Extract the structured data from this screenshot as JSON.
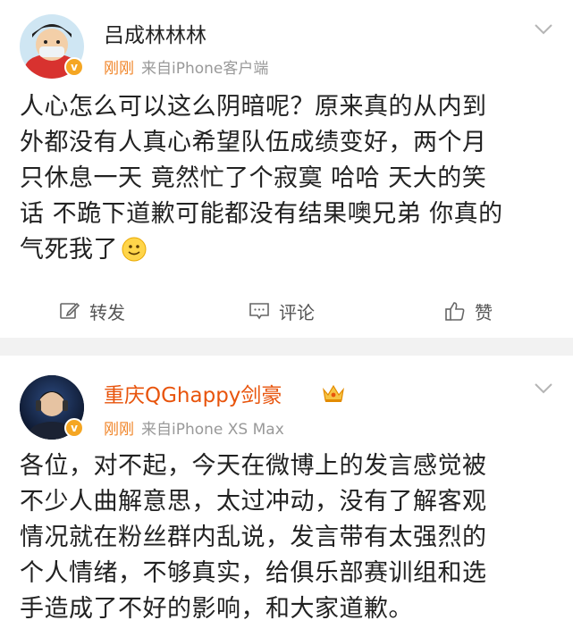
{
  "posts": [
    {
      "username": "吕成林林林",
      "time": "刚刚",
      "source": "来自iPhone客户端",
      "verified_badge": "v",
      "content_lines": [
        "人心怎么可以这么阴暗呢？原来真的从内到",
        "外都没有人真心希望队伍成绩变好，两个月",
        "只休息一天 竟然忙了个寂寞 哈哈 天大的笑",
        "话 不跪下道歉可能都没有结果噢兄弟 你真的",
        "气死我了"
      ],
      "actions": {
        "repost": "转发",
        "comment": "评论",
        "like": "赞"
      }
    },
    {
      "username": "重庆QGhappy剑豪",
      "time": "刚刚",
      "source": "来自iPhone XS Max",
      "verified_badge": "v",
      "content_lines": [
        "各位，对不起，今天在微博上的发言感觉被",
        "不少人曲解意思，太过冲动，没有了解客观",
        "情况就在粉丝群内乱说，发言带有太强烈的",
        "个人情绪，不够真实，给俱乐部赛训组和选",
        "手造成了不好的影响，和大家道歉。"
      ]
    }
  ],
  "colors": {
    "time_orange": "#f08427",
    "vip_name_orange": "#e8540c",
    "separator": "#f2f2f2"
  },
  "icons": {
    "repost": "compose-icon",
    "comment": "comment-icon",
    "like": "thumbs-up-icon",
    "more": "chevron-down-icon",
    "emoji": "smiley-emoji-icon",
    "vip": "crown-icon"
  }
}
